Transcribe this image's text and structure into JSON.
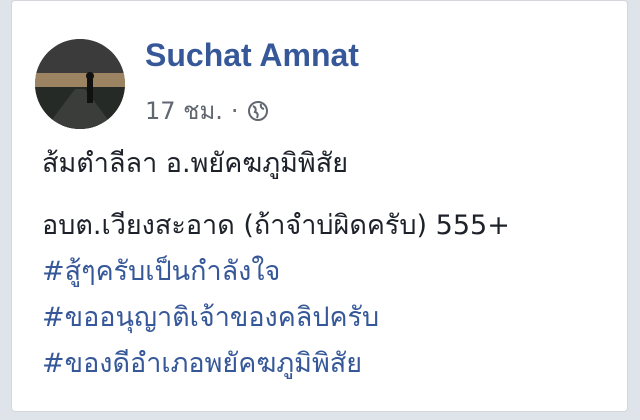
{
  "post": {
    "author": "Suchat Amnat",
    "timestamp": "17 ชม.",
    "separator": "·",
    "privacy_icon": "globe-icon",
    "lines": [
      "ส้มตำลีลา อ.พยัคฆภูมิพิสัย",
      "อบต.เวียงสะอาด (ถ้าจำบ่ผิดครับ) 555+"
    ],
    "hashtags": [
      "#สู้ๆครับเป็นกำลังใจ",
      "#ขออนุญาติเจ้าของคลิปครับ",
      "#ของดีอำเภอพยัคฆภูมิพิสัย"
    ]
  },
  "colors": {
    "link": "#365899",
    "text": "#1d2129",
    "meta": "#616770"
  }
}
